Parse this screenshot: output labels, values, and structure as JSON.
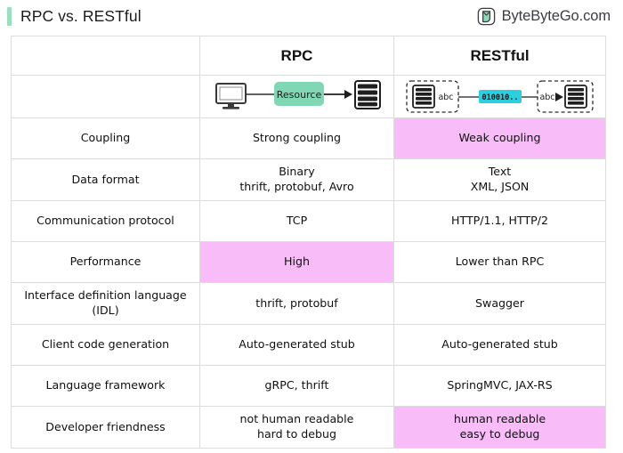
{
  "header": {
    "title": "RPC vs. RESTful",
    "brand_name": "ByteByteGo.com",
    "brand_icon": "bytebytego-logo-icon",
    "accent_color": "#9adfbf"
  },
  "table": {
    "columns": [
      "",
      "RPC",
      "RESTful"
    ],
    "highlight_color": "#f8bdf8",
    "diagram_row": {
      "rpc": {
        "client_icon": "monitor-icon",
        "middle_label": "Resource",
        "middle_color": "#7fd7b4",
        "server_icon": "server-rack-icon",
        "arrow_icon": "arrow-right-icon"
      },
      "restful": {
        "left_server_icon": "server-rack-icon",
        "left_label": "abc",
        "payload_label": "010010..",
        "payload_color": "#2ad0e0",
        "right_label": "abc",
        "right_server_icon": "server-rack-icon",
        "arrow_icon": "arrow-right-icon",
        "boundary_style": "dashed-boundary"
      }
    },
    "rows": [
      {
        "label": "Coupling",
        "rpc": [
          "Strong coupling"
        ],
        "restful": [
          "Weak coupling"
        ],
        "rpc_highlight": false,
        "restful_highlight": true
      },
      {
        "label": "Data format",
        "rpc": [
          "Binary",
          "thrift, protobuf, Avro"
        ],
        "restful": [
          "Text",
          "XML, JSON"
        ],
        "rpc_highlight": false,
        "restful_highlight": false
      },
      {
        "label": "Communication protocol",
        "rpc": [
          "TCP"
        ],
        "restful": [
          "HTTP/1.1, HTTP/2"
        ],
        "rpc_highlight": false,
        "restful_highlight": false
      },
      {
        "label": "Performance",
        "rpc": [
          "High"
        ],
        "restful": [
          "Lower than RPC"
        ],
        "rpc_highlight": true,
        "restful_highlight": false
      },
      {
        "label": "Interface definition language (IDL)",
        "label_lines": [
          "Interface definition language",
          "(IDL)"
        ],
        "rpc": [
          "thrift, protobuf"
        ],
        "restful": [
          "Swagger"
        ],
        "rpc_highlight": false,
        "restful_highlight": false
      },
      {
        "label": "Client code generation",
        "rpc": [
          "Auto-generated stub"
        ],
        "restful": [
          "Auto-generated stub"
        ],
        "rpc_highlight": false,
        "restful_highlight": false
      },
      {
        "label": "Language framework",
        "rpc": [
          "gRPC, thrift"
        ],
        "restful": [
          "SpringMVC, JAX-RS"
        ],
        "rpc_highlight": false,
        "restful_highlight": false
      },
      {
        "label": "Developer friendness",
        "rpc": [
          "not human readable",
          "hard to debug"
        ],
        "restful": [
          "human readable",
          "easy to debug"
        ],
        "rpc_highlight": false,
        "restful_highlight": true
      }
    ]
  }
}
